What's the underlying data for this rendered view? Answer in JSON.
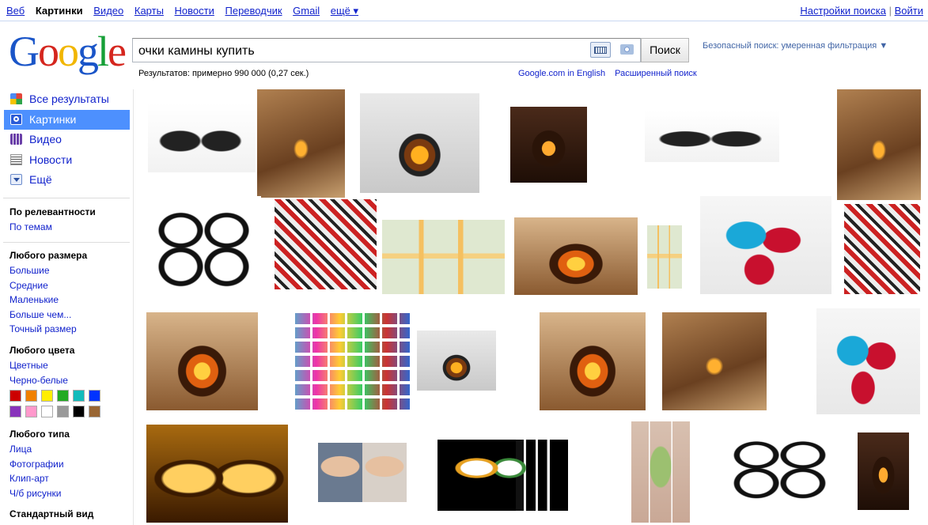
{
  "topnav": {
    "items": [
      "Веб",
      "Картинки",
      "Видео",
      "Карты",
      "Новости",
      "Переводчик",
      "Gmail",
      "ещё ▾"
    ],
    "current": 1
  },
  "toplinks": {
    "settings": "Настройки поиска",
    "sep": "|",
    "login": "Войти"
  },
  "logo": {
    "letters": [
      "G",
      "o",
      "o",
      "g",
      "l",
      "e"
    ]
  },
  "search": {
    "query": "очки камины купить",
    "button": "Поиск"
  },
  "safe_search": "Безопасный поиск: умеренная фильтрация ▼",
  "stats": "Результатов: примерно 990 000 (0,27 сек.)",
  "links": {
    "english": "Google.com in English",
    "advanced": "Расширенный поиск"
  },
  "leftnav": {
    "items": [
      {
        "label": "Все результаты",
        "icon": "all-results-icon"
      },
      {
        "label": "Картинки",
        "icon": "images-icon",
        "selected": true
      },
      {
        "label": "Видео",
        "icon": "video-icon"
      },
      {
        "label": "Новости",
        "icon": "news-icon"
      },
      {
        "label": "Ещё",
        "icon": "more-icon"
      }
    ],
    "sort": {
      "header": "По релевантности",
      "options": [
        "По темам"
      ]
    },
    "size": {
      "header": "Любого размера",
      "options": [
        "Большие",
        "Средние",
        "Маленькие",
        "Больше чем...",
        "Точный размер"
      ]
    },
    "color": {
      "header": "Любого цвета",
      "options": [
        "Цветные",
        "Черно-белые"
      ],
      "swatches": [
        "#cc0000",
        "#f08000",
        "#ffee00",
        "#22aa22",
        "#11bbbb",
        "#0033ff",
        "#8833bb",
        "#ff99cc",
        "#ffffff",
        "#999999",
        "#000000",
        "#996633"
      ]
    },
    "type": {
      "header": "Любого типа",
      "options": [
        "Лица",
        "Фотографии",
        "Клип-арт",
        "Ч/б рисунки"
      ]
    },
    "view": {
      "header": "Стандартный вид"
    }
  },
  "thumbs": [
    {
      "name": "thumb-aviator-sunglasses",
      "kind": "glasses"
    },
    {
      "name": "thumb-stove-children",
      "kind": "room"
    },
    {
      "name": "thumb-white-fireplace",
      "kind": "fireplace-white"
    },
    {
      "name": "thumb-dark-fireplace",
      "kind": "fireplace-dark"
    },
    {
      "name": "thumb-wayfarer-sunglasses",
      "kind": "glasses"
    },
    {
      "name": "thumb-classic-fireplace-room",
      "kind": "room"
    },
    {
      "name": "thumb-black-glasses-pair",
      "kind": "glasses-white"
    },
    {
      "name": "thumb-glasses-pile",
      "kind": "collage"
    },
    {
      "name": "thumb-yandex-map",
      "kind": "map"
    },
    {
      "name": "thumb-stone-fireplace",
      "kind": "fireplace-warm"
    },
    {
      "name": "thumb-map-small",
      "kind": "map"
    },
    {
      "name": "thumb-3d-glasses",
      "kind": "glasses-3d"
    },
    {
      "name": "thumb-sunglasses-stack",
      "kind": "collage"
    },
    {
      "name": "thumb-corner-fireplace",
      "kind": "fireplace-warm"
    },
    {
      "name": "thumb-sunglasses-grid",
      "kind": "grid"
    },
    {
      "name": "thumb-white-portal",
      "kind": "fireplace-white"
    },
    {
      "name": "thumb-brick-fireplace",
      "kind": "fireplace-warm"
    },
    {
      "name": "thumb-pyramid-fireplace",
      "kind": "room"
    },
    {
      "name": "thumb-red-3d-glasses",
      "kind": "glasses-3d"
    },
    {
      "name": "thumb-pinhole-glasses",
      "kind": "amber"
    },
    {
      "name": "thumb-celebrity-glasses",
      "kind": "faces"
    },
    {
      "name": "thumb-painted-glasses",
      "kind": "glasses-dark"
    },
    {
      "name": "thumb-window-room",
      "kind": "window"
    },
    {
      "name": "thumb-black-3d-glasses",
      "kind": "glasses-white"
    },
    {
      "name": "thumb-cast-iron-stove",
      "kind": "fireplace-dark"
    }
  ]
}
